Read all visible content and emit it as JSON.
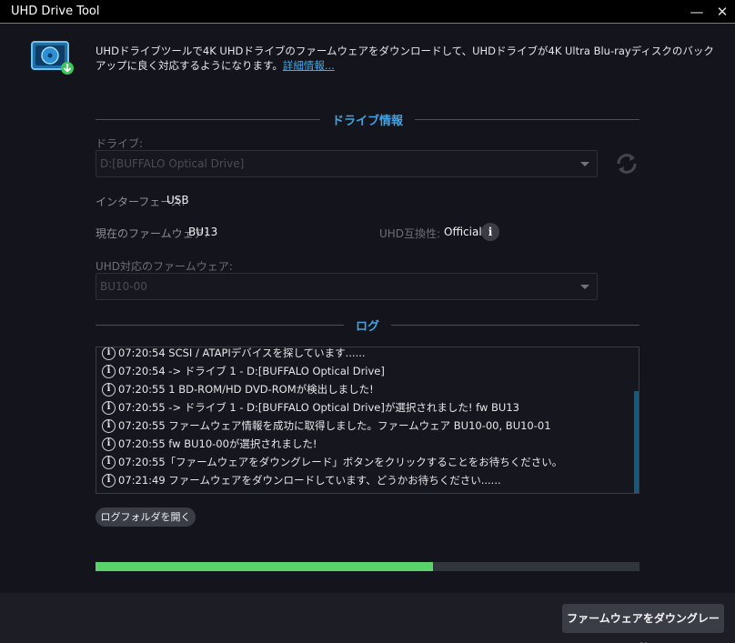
{
  "window": {
    "title": "UHD Drive Tool",
    "minimize": "—",
    "close": "✕"
  },
  "header": {
    "description": "UHDドライブツールで4K UHDドライブのファームウェアをダウンロードして、UHDドライブが4K Ultra Blu-rayディスクのバックアップに良く対応するようになります。",
    "details_link": "詳細情報..."
  },
  "drive_section": {
    "title": "ドライブ情報",
    "drive_label": "ドライブ:",
    "drive_value": "D:[BUFFALO Optical Drive]",
    "interface_label": "インターフェース:",
    "interface_value": "USB",
    "current_fw_label": "現在のファームウェア:",
    "current_fw_value": "BU13",
    "uhd_compat_label": "UHD互換性:",
    "uhd_compat_value": "Official",
    "uhd_fw_label": "UHD対応のファームウェア:",
    "uhd_fw_value": "BU10-00"
  },
  "log_section": {
    "title": "ログ",
    "entries": [
      "07:20:54 SCSI / ATAPIデバイスを探しています......",
      "07:20:54 -> ドライブ 1 - D:[BUFFALO Optical Drive]",
      "07:20:55 1 BD-ROM/HD DVD-ROMが検出しました!",
      "07:20:55 -> ドライブ 1 - D:[BUFFALO Optical Drive]が選択されました! fw BU13",
      "07:20:55 ファームウェア情報を成功に取得しました。ファームウェア BU10-00, BU10-01",
      "07:20:55 fw BU10-00が選択されました!",
      "07:20:55「ファームウェアをダウングレード」ボタンをクリックすることをお待ちください。",
      "07:21:49 ファームウェアをダウンロードしています、どうかお待ちください......"
    ],
    "open_folder_button": "ログフォルダを開く"
  },
  "progress": {
    "fraction": 0.62
  },
  "footer": {
    "downgrade_button": "ファームウェアをダウングレード"
  },
  "colors": {
    "accent": "#3fa3e6",
    "progress": "#59d26a",
    "link": "#45a9e6"
  }
}
